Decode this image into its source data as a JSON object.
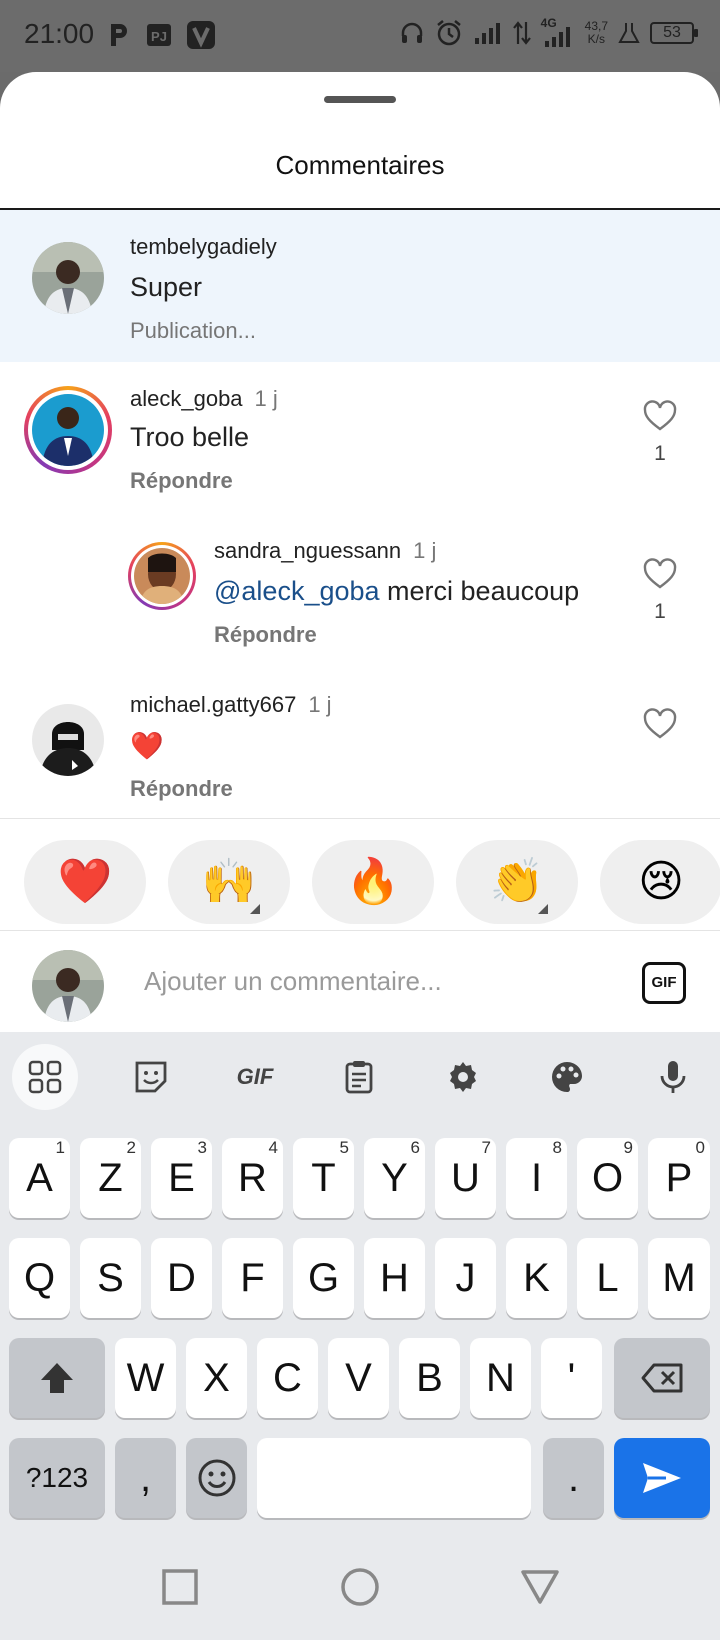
{
  "status_bar": {
    "time": "21:00",
    "net_speed_value": "43,7",
    "net_speed_unit": "K/s",
    "network_label": "4G",
    "battery": "53"
  },
  "sheet": {
    "title": "Commentaires"
  },
  "comments": [
    {
      "username": "tembelygadiely",
      "time": "",
      "text": "Super",
      "sub": "Publication..."
    },
    {
      "username": "aleck_goba",
      "time": "1 j",
      "text": "Troo belle",
      "sub": "Répondre",
      "likes": "1"
    },
    {
      "username": "sandra_nguessann",
      "time": "1 j",
      "mention": "@aleck_goba",
      "text": " merci beaucoup",
      "sub": "Répondre",
      "likes": "1"
    },
    {
      "username": "michael.gatty667",
      "time": "1 j",
      "text": "❤️",
      "sub": "Répondre"
    }
  ],
  "reactions": [
    "❤️",
    "🙌",
    "🔥",
    "👏",
    "😢"
  ],
  "composer": {
    "placeholder": "Ajouter un commentaire...",
    "gif_label": "GIF"
  },
  "keyboard": {
    "toolbar_gif": "GIF",
    "row1": [
      {
        "k": "A",
        "h": "1"
      },
      {
        "k": "Z",
        "h": "2"
      },
      {
        "k": "E",
        "h": "3"
      },
      {
        "k": "R",
        "h": "4"
      },
      {
        "k": "T",
        "h": "5"
      },
      {
        "k": "Y",
        "h": "6"
      },
      {
        "k": "U",
        "h": "7"
      },
      {
        "k": "I",
        "h": "8"
      },
      {
        "k": "O",
        "h": "9"
      },
      {
        "k": "P",
        "h": "0"
      }
    ],
    "row2": [
      "Q",
      "S",
      "D",
      "F",
      "G",
      "H",
      "J",
      "K",
      "L",
      "M"
    ],
    "row3": [
      "W",
      "X",
      "C",
      "V",
      "B",
      "N",
      "'"
    ],
    "symbols_label": "?123",
    "comma": ",",
    "period": "."
  }
}
